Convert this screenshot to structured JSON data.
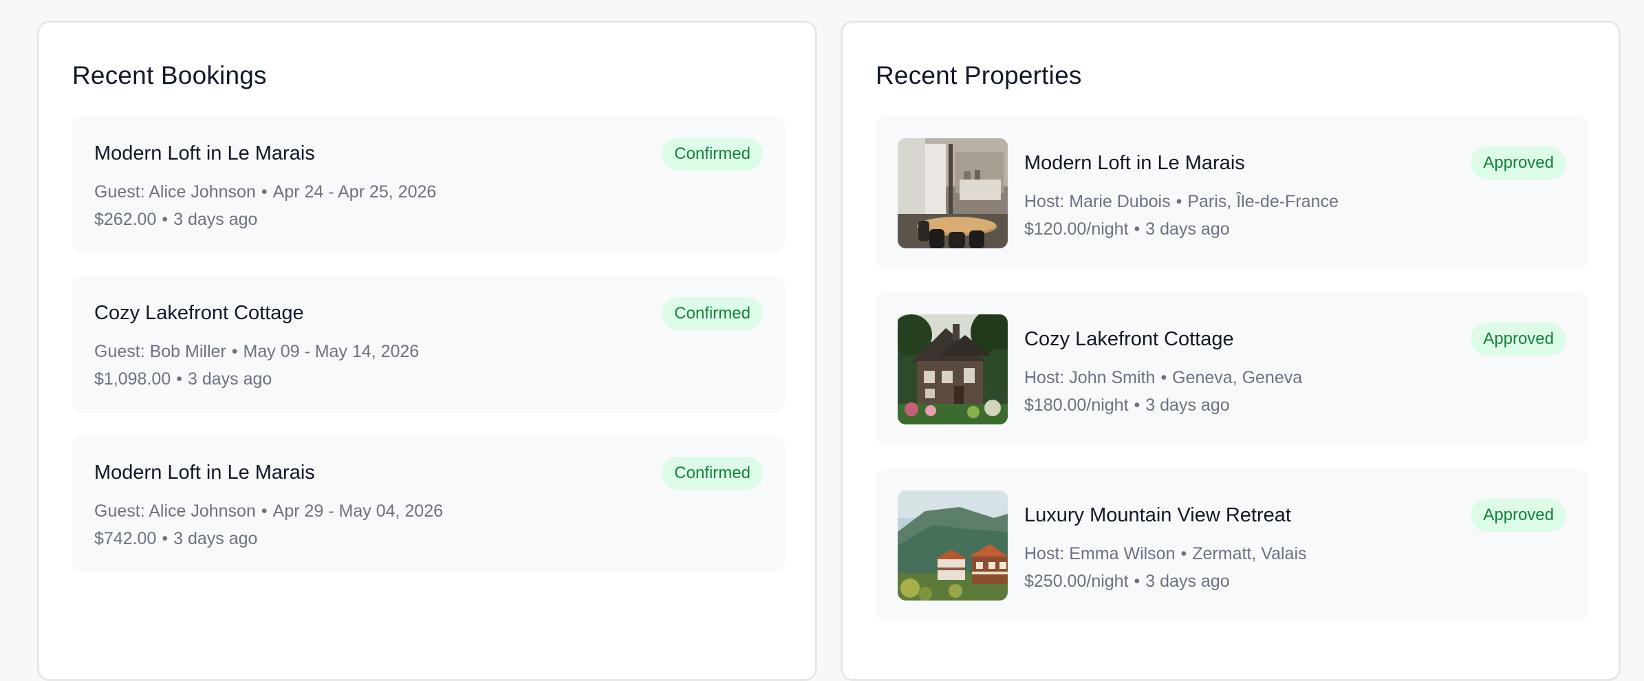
{
  "bookings": {
    "title": "Recent Bookings",
    "items": [
      {
        "property": "Modern Loft in Le Marais",
        "status": "Confirmed",
        "guest": "Guest: Alice Johnson",
        "dates": "Apr 24 - Apr 25, 2026",
        "price": "$262.00",
        "ago": "3 days ago"
      },
      {
        "property": "Cozy Lakefront Cottage",
        "status": "Confirmed",
        "guest": "Guest: Bob Miller",
        "dates": "May 09 - May 14, 2026",
        "price": "$1,098.00",
        "ago": "3 days ago"
      },
      {
        "property": "Modern Loft in Le Marais",
        "status": "Confirmed",
        "guest": "Guest: Alice Johnson",
        "dates": "Apr 29 - May 04, 2026",
        "price": "$742.00",
        "ago": "3 days ago"
      }
    ]
  },
  "properties": {
    "title": "Recent Properties",
    "items": [
      {
        "name": "Modern Loft in Le Marais",
        "status": "Approved",
        "host": "Host: Marie Dubois",
        "location": "Paris, Île-de-France",
        "price": "$120.00/night",
        "ago": "3 days ago",
        "image": "loft-interior-photo"
      },
      {
        "name": "Cozy Lakefront Cottage",
        "status": "Approved",
        "host": "Host: John Smith",
        "location": "Geneva, Geneva",
        "price": "$180.00/night",
        "ago": "3 days ago",
        "image": "stone-cottage-photo"
      },
      {
        "name": "Luxury Mountain View Retreat",
        "status": "Approved",
        "host": "Host: Emma Wilson",
        "location": "Zermatt, Valais",
        "price": "$250.00/night",
        "ago": "3 days ago",
        "image": "mountain-chalet-photo"
      }
    ]
  },
  "separator": "•",
  "colors": {
    "badge_bg": "#dcfce7",
    "badge_text": "#15803d",
    "card_bg": "#f8f9fb",
    "muted_text": "#6b7280"
  }
}
